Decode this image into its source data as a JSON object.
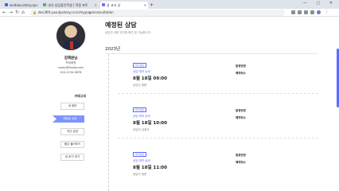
{
  "browser": {
    "tabs": [
      {
        "label": "wndow.ustory.ay"
      },
      {
        "label": "내가 상담중인학생 | 학원 포트"
      },
      {
        "label": "상 교사 상"
      }
    ],
    "new_tab": "+",
    "window_controls": "— ▢ ✕",
    "url": "dev369.yusuljustory.co.kr/mypage/consultation",
    "nav": {
      "back": "←",
      "forward": "→",
      "reload": "↻",
      "home": "⌂"
    }
  },
  "sidebar": {
    "user": {
      "name": "김해원님",
      "role": "학생회원",
      "email": "sushy@hsoily.com",
      "phone": "010-1234-5678"
    },
    "menu_title": "카테고리",
    "menu": [
      {
        "label": "내 정보",
        "active": false
      },
      {
        "label": "예정된 상담",
        "active": true
      },
      {
        "label": "지난 상담",
        "active": false
      },
      {
        "label": "좋은 둘러보기",
        "active": false
      },
      {
        "label": "내 후기 보기",
        "active": false
      }
    ]
  },
  "main": {
    "title": "예정된 상담",
    "subtitle": "상담전 내용 안전에 확인 및 가능합니다.",
    "year": "2023년",
    "consultations": [
      {
        "badge": "대기상담",
        "type": "상담 예약 상세",
        "date": "8월 18일 09:00",
        "counselor": "상담사 정한",
        "action_primary": "일정변경",
        "action_secondary": "예약취소"
      },
      {
        "badge": "대기상담",
        "type": "상담 예약 상세",
        "date": "8월 18일 10:00",
        "counselor": "상담사 김경석",
        "action_primary": "일정변경",
        "action_secondary": "예약취소"
      },
      {
        "badge": "대기상담",
        "type": "상담 예약 상세",
        "date": "8월 18일 11:00",
        "counselor": "상담사 정한",
        "action_primary": "일정변경",
        "action_secondary": "예약취소"
      }
    ]
  },
  "colors": {
    "accent": "#5b6cff",
    "active_menu": "#7d93ff"
  }
}
